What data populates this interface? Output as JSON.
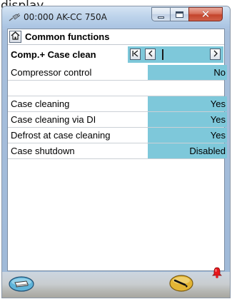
{
  "window": {
    "caption_fragment": "display",
    "title": "00:000 AK-CC 750A"
  },
  "menu": {
    "title": "Common functions"
  },
  "group": {
    "title": "Comp.+ Case clean"
  },
  "params": [
    {
      "label": "Compressor control",
      "value": "No"
    },
    {
      "label": "",
      "value": ""
    },
    {
      "label": "Case cleaning",
      "value": "Yes"
    },
    {
      "label": "Case cleaning via DI",
      "value": "Yes"
    },
    {
      "label": "Defrost at case cleaning",
      "value": "Yes"
    },
    {
      "label": "Case shutdown",
      "value": "Disabled"
    }
  ],
  "icons": {
    "app": "plug-icon",
    "home": "home-icon",
    "first": "first-page-icon",
    "prev": "previous-icon",
    "next": "next-icon",
    "left_footer": "device-icon",
    "right_footer": "wrench-icon",
    "alarm": "alarm-bell-icon"
  },
  "colors": {
    "value_cell": "#7ec8da",
    "close_button": "#c4452c",
    "alarm": "#e8161b"
  }
}
